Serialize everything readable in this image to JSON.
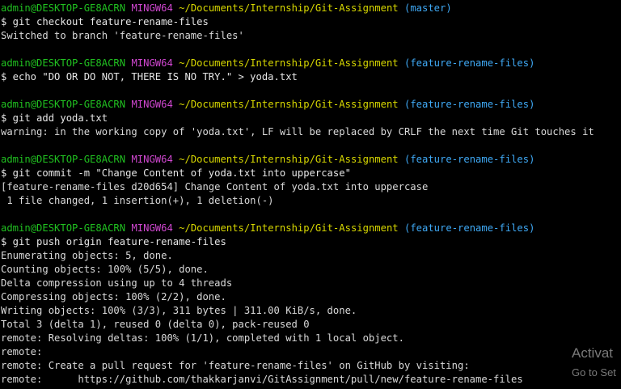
{
  "prompt": {
    "user_host": "admin@DESKTOP-GE8ACRN",
    "shell": "MINGW64",
    "path": "~/Documents/Internship/Git-Assignment"
  },
  "blocks": [
    {
      "branch": "(master)",
      "command": "$ git checkout feature-rename-files",
      "output": [
        "Switched to branch 'feature-rename-files'"
      ]
    },
    {
      "branch": "(feature-rename-files)",
      "command": "$ echo \"DO OR DO NOT, THERE IS NO TRY.\" > yoda.txt",
      "output": []
    },
    {
      "branch": "(feature-rename-files)",
      "command": "$ git add yoda.txt",
      "output": [
        "warning: in the working copy of 'yoda.txt', LF will be replaced by CRLF the next time Git touches it"
      ]
    },
    {
      "branch": "(feature-rename-files)",
      "command": "$ git commit -m \"Change Content of yoda.txt into uppercase\"",
      "output": [
        "[feature-rename-files d20d654] Change Content of yoda.txt into uppercase",
        " 1 file changed, 1 insertion(+), 1 deletion(-)"
      ]
    },
    {
      "branch": "(feature-rename-files)",
      "command": "$ git push origin feature-rename-files",
      "output": [
        "Enumerating objects: 5, done.",
        "Counting objects: 100% (5/5), done.",
        "Delta compression using up to 4 threads",
        "Compressing objects: 100% (2/2), done.",
        "Writing objects: 100% (3/3), 311 bytes | 311.00 KiB/s, done.",
        "Total 3 (delta 1), reused 0 (delta 0), pack-reused 0",
        "remote: Resolving deltas: 100% (1/1), completed with 1 local object.",
        "remote:",
        "remote: Create a pull request for 'feature-rename-files' on GitHub by visiting:",
        "remote:      https://github.com/thakkarjanvi/GitAssignment/pull/new/feature-rename-files"
      ]
    }
  ],
  "watermark": {
    "title": "Activat",
    "subtitle": "Go to Set"
  },
  "colors": {
    "background": "#000000",
    "user_host": "#20c020",
    "shell": "#d047d0",
    "path": "#d8d800",
    "branch": "#3fa9f5",
    "text": "#d9d9d9"
  }
}
